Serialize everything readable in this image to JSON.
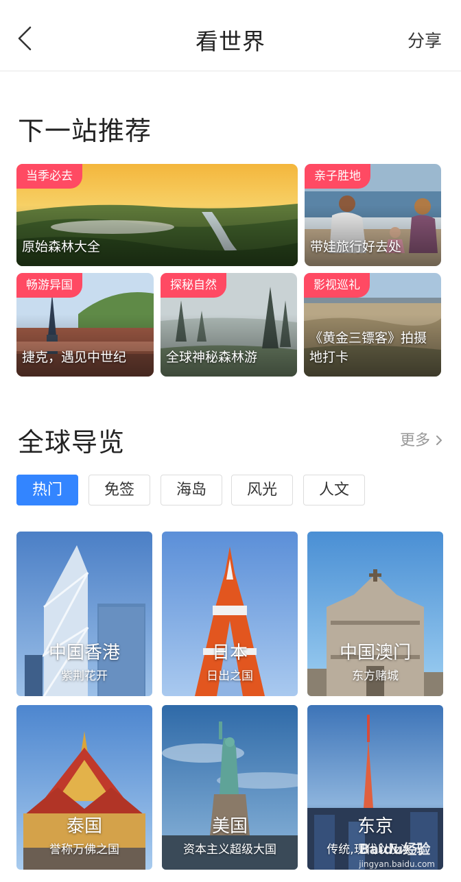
{
  "header": {
    "title": "看世界",
    "share_label": "分享",
    "back_icon": "chevron-left-icon"
  },
  "recommend": {
    "section_title": "下一站推荐",
    "tag_color": "#ff4a63",
    "cards": [
      {
        "tag": "当季必去",
        "caption": "原始森林大全"
      },
      {
        "tag": "亲子胜地",
        "caption": "带娃旅行好去处"
      },
      {
        "tag": "畅游异国",
        "caption": "捷克，遇见中世纪"
      },
      {
        "tag": "探秘自然",
        "caption": "全球神秘森林游"
      },
      {
        "tag": "影视巡礼",
        "caption": "《黄金三镖客》拍摄地打卡"
      }
    ]
  },
  "guide": {
    "section_title": "全球导览",
    "more_label": "更多",
    "accent_color": "#3385ff",
    "tabs": [
      {
        "label": "热门",
        "active": true
      },
      {
        "label": "免签",
        "active": false
      },
      {
        "label": "海岛",
        "active": false
      },
      {
        "label": "风光",
        "active": false
      },
      {
        "label": "人文",
        "active": false
      }
    ],
    "destinations": [
      {
        "name": "中国香港",
        "subtitle": "紫荆花开"
      },
      {
        "name": "日本",
        "subtitle": "日出之国"
      },
      {
        "name": "中国澳门",
        "subtitle": "东方赌城"
      },
      {
        "name": "泰国",
        "subtitle": "誉称万佛之国"
      },
      {
        "name": "美国",
        "subtitle": "资本主义超级大国"
      },
      {
        "name": "东京",
        "subtitle": "传统,现代以及次元"
      }
    ]
  },
  "watermark": {
    "text": "Baidu经验",
    "url_text": "jingyan.baidu.com"
  }
}
